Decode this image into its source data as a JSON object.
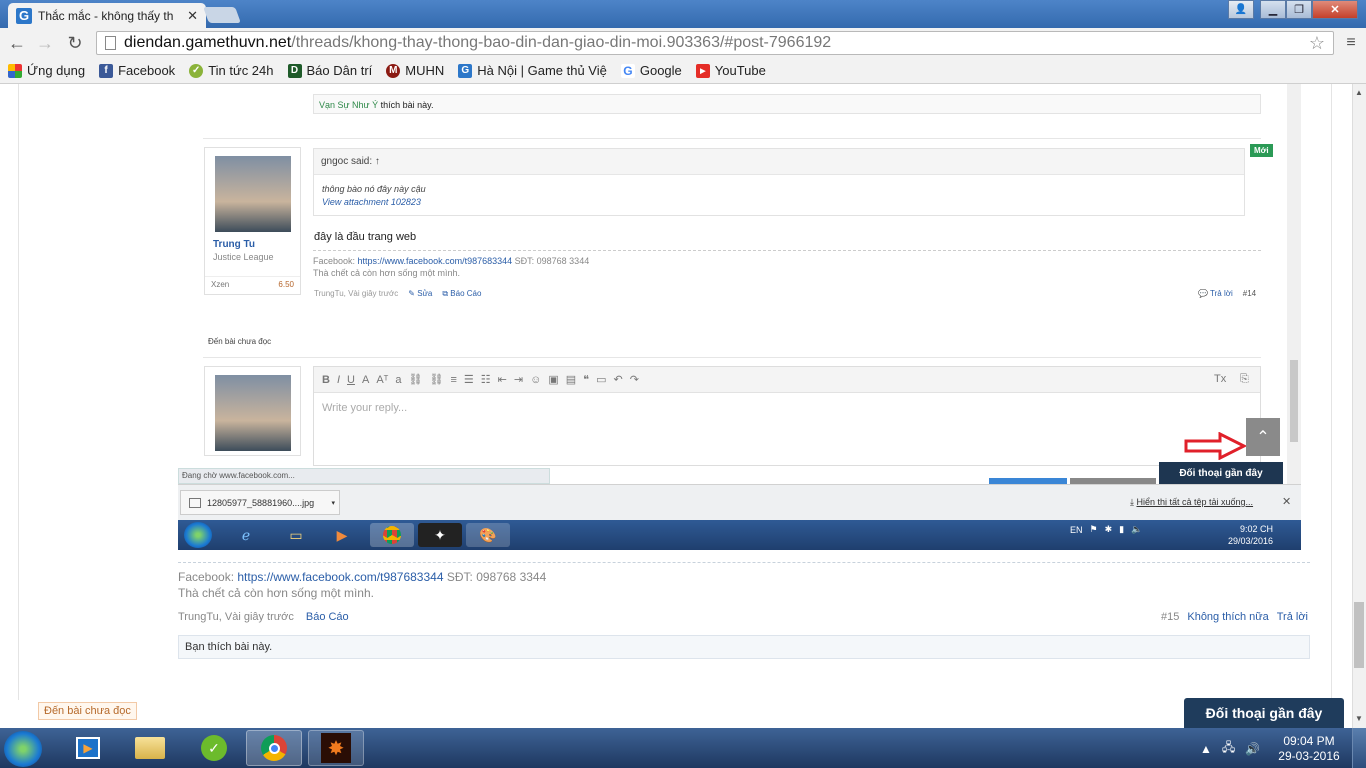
{
  "browser": {
    "tab_title": "Thắc mắc - không thấy th",
    "tab_icon": "G",
    "url_host": "diendan.gamethuvn.net",
    "url_path": "/threads/khong-thay-thong-bao-din-dan-giao-din-moi.903363/#post-7966192"
  },
  "bookmarks": [
    {
      "label": "Ứng dụng",
      "icon": "apps-icon"
    },
    {
      "label": "Facebook",
      "icon": "facebook-icon"
    },
    {
      "label": "Tin tức 24h",
      "icon": "news-icon"
    },
    {
      "label": "Báo Dân trí",
      "icon": "dantri-icon"
    },
    {
      "label": "MUHN",
      "icon": "muhn-icon"
    },
    {
      "label": "Hà Nội | Game thủ Việ",
      "icon": "gamethu-icon"
    },
    {
      "label": "Google",
      "icon": "google-icon"
    },
    {
      "label": "YouTube",
      "icon": "youtube-icon"
    }
  ],
  "embedded": {
    "like_text_name": "Vạn Sự Như Ý",
    "like_text_rest": " thích bài này.",
    "new_badge": "Mới",
    "quote_author": "gngoc said: ↑",
    "quote_line1": "thông bào nó đây này cậu",
    "quote_line2": "View attachment 102823",
    "user_name": "Trung Tu",
    "user_title": "Justice League",
    "user_currency": "Xzen",
    "user_points": "6.50",
    "message": "đây là đầu trang web",
    "sig_prefix": "Facebook: ",
    "sig_link": "https://www.facebook.com/t987683344",
    "sig_phone": " SĐT: 098768 3344",
    "sig_line2": "Thà chết cả còn hơn sống một mình.",
    "meta_author": "TrungTu, Vài giây trước",
    "edit_label": "Sửa",
    "report_label": "Báo Cáo",
    "reply_label": "Trả lời",
    "post_number": "#14",
    "unread_label": "Đến bài chưa đọc",
    "editor_placeholder": "Write your reply...",
    "conversations_label": "Đối thoại gần đây",
    "status_text": "Đang chờ www.facebook.com...",
    "download_file": "12805977_58881960....jpg",
    "download_show_all": "Hiển thị tất cả tệp tải xuống...",
    "tray_lang": "EN",
    "clock_time": "9:02 CH",
    "clock_date": "29/03/2016"
  },
  "post": {
    "sig_prefix": "Facebook: ",
    "sig_link": "https://www.facebook.com/t987683344",
    "sig_phone": " SĐT: 098768 3344",
    "sig_line2": "Thà chết cả còn hơn sống một mình.",
    "meta_author": "TrungTu, Vài giây trước",
    "report_label": "Báo Cáo",
    "post_number": "#15",
    "unlike_label": "Không thích nữa",
    "reply_label": "Trả lời",
    "like_text": "Bạn thích bài này."
  },
  "page": {
    "unread_label": "Đến bài chưa đọc",
    "conversations_label": "Đối thoại gần đây"
  },
  "taskbar": {
    "clock_time": "09:04 PM",
    "clock_date": "29-03-2016"
  },
  "colors": {
    "link": "#2b5ea8",
    "new_badge": "#2b9a56",
    "conversation_bar": "#1f3c5c",
    "arrow": "#e0202a"
  }
}
